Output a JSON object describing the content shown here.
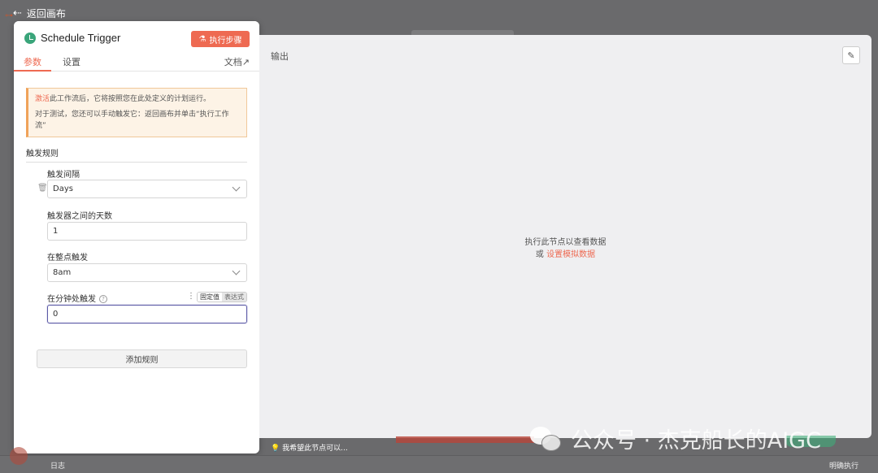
{
  "header": {
    "back_label": "返回画布"
  },
  "node": {
    "title": "Schedule Trigger",
    "execute_label": "执行步骤",
    "tabs": {
      "params": "参数",
      "settings": "设置",
      "docs": "文档"
    }
  },
  "notice": {
    "highlight": "激活",
    "line1": "此工作流后，它将按照您在此处定义的计划运行。",
    "line2": "对于测试，您还可以手动触发它：返回画布并单击“执行工作流”"
  },
  "rules": {
    "section_title": "触发规则",
    "interval_label": "触发间隔",
    "interval_value": "Days",
    "days_between_label": "触发器之间的天数",
    "days_between_value": "1",
    "hour_label": "在整点触发",
    "hour_value": "8am",
    "minute_label": "在分钟处触发",
    "minute_value": "0",
    "mode_fixed": "固定值",
    "mode_expression": "表达式",
    "add_rule_label": "添加规则"
  },
  "output": {
    "title": "输出",
    "empty_line1": "执行此节点以查看数据",
    "empty_or": "或",
    "empty_link": "设置模拟数据"
  },
  "bottom": {
    "log_label": "日志",
    "hint": "我希望此节点可以...",
    "run_label": "明确执行"
  },
  "watermark": {
    "text": "公众号 · 杰克船长的AIGC"
  },
  "colors": {
    "accent": "#ee6a52",
    "trigger_green": "#3aa57a",
    "focus": "#5b5aa6"
  },
  "icons": [
    "back-arrow-icon",
    "clock-icon",
    "flask-icon",
    "external-link-icon",
    "trash-icon",
    "chevron-down-icon",
    "help-icon",
    "more-dots-icon",
    "edit-pencil-icon",
    "lightbulb-icon",
    "wechat-logo-icon"
  ]
}
